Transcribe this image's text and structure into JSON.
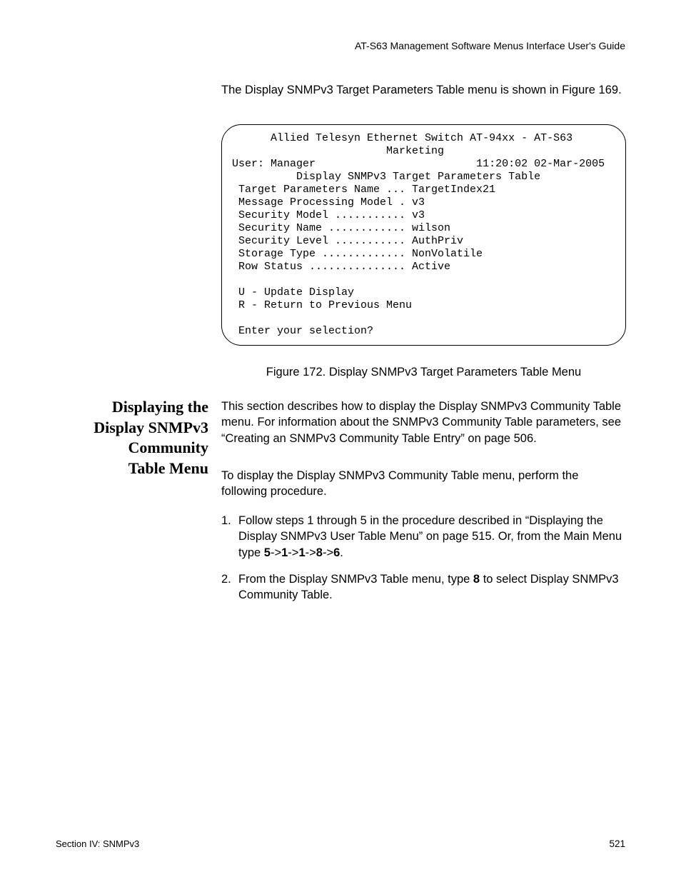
{
  "header": {
    "guide_title": "AT-S63 Management Software Menus Interface User's Guide"
  },
  "intro": {
    "text": "The Display SNMPv3 Target Parameters Table menu is shown in Figure 169."
  },
  "terminal": {
    "line_title1": "Allied Telesyn Ethernet Switch AT-94xx - AT-S63",
    "line_title2": "Marketing",
    "user_label": "User: Manager",
    "timestamp": "11:20:02 02-Mar-2005",
    "subtitle": "Display SNMPv3 Target Parameters Table",
    "rows": {
      "target_params_name": " Target Parameters Name ... TargetIndex21",
      "msg_proc_model": " Message Processing Model . v3",
      "security_model": " Security Model ........... v3",
      "security_name": " Security Name ............ wilson",
      "security_level": " Security Level ........... AuthPriv",
      "storage_type": " Storage Type ............. NonVolatile",
      "row_status": " Row Status ............... Active"
    },
    "opt_u": " U - Update Display",
    "opt_r": " R - Return to Previous Menu",
    "prompt": " Enter your selection?"
  },
  "figure_caption": "Figure 172. Display SNMPv3 Target Parameters Table Menu",
  "side_heading": {
    "l1": "Displaying the",
    "l2": "Display SNMPv3",
    "l3": "Community",
    "l4": "Table Menu"
  },
  "body": {
    "p1": "This section describes how to display the Display SNMPv3 Community Table menu. For information about the SNMPv3 Community Table parameters, see “Creating an SNMPv3 Community Table Entry” on page 506.",
    "p2": "To display the Display SNMPv3 Community Table menu, perform the following procedure."
  },
  "steps": {
    "s1": {
      "num": "1.",
      "pre": "Follow steps 1 through 5 in the procedure described in “Displaying the Display SNMPv3 User Table Menu” on page 515. Or, from the Main Menu type ",
      "b1": "5",
      "a1": "->",
      "b2": "1",
      "a2": "->",
      "b3": "1",
      "a3": "->",
      "b4": "8",
      "a4": "->",
      "b5": "6",
      "a5": "."
    },
    "s2": {
      "num": "2.",
      "pre": "From the Display SNMPv3 Table menu, type ",
      "b1": "8",
      "post": " to select Display SNMPv3 Community Table."
    }
  },
  "footer": {
    "left": "Section IV: SNMPv3",
    "right": "521"
  }
}
